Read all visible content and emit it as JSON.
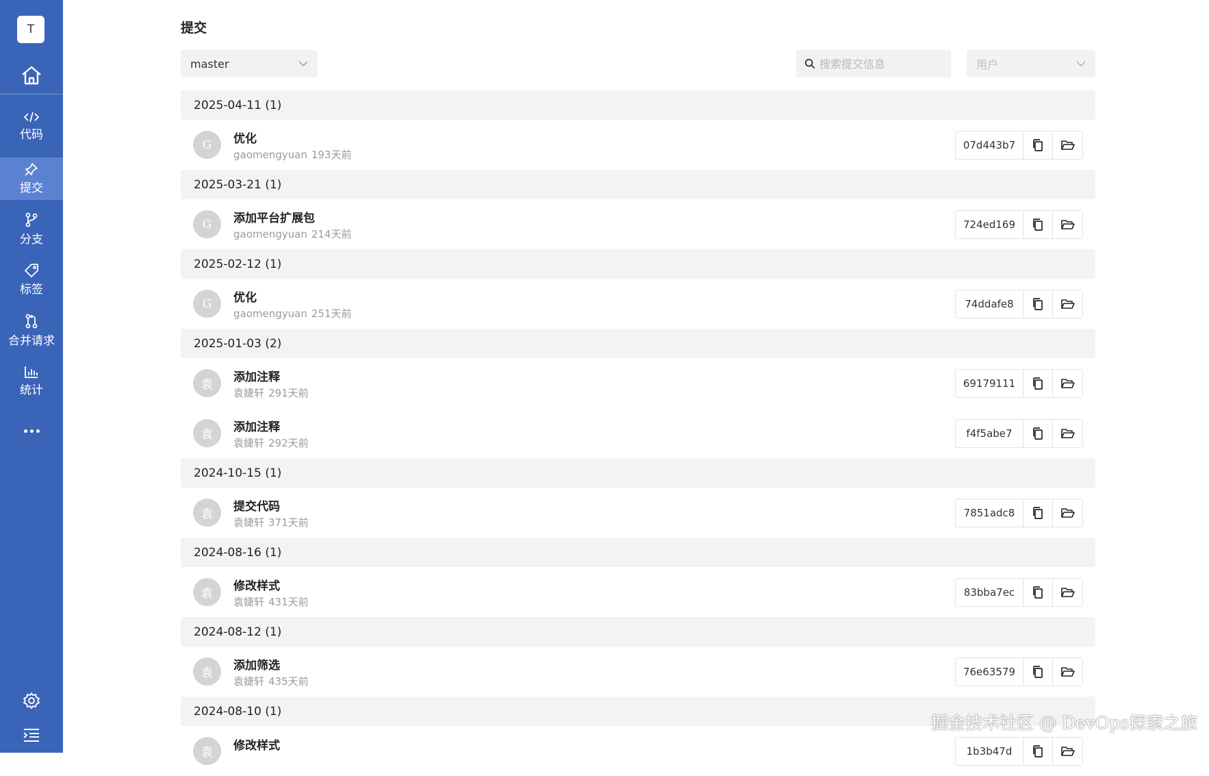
{
  "sidebar": {
    "user_initial": "T",
    "items": [
      {
        "label": "代码",
        "icon": "code-icon"
      },
      {
        "label": "提交",
        "icon": "pin-icon",
        "active": true
      },
      {
        "label": "分支",
        "icon": "branch-icon"
      },
      {
        "label": "标签",
        "icon": "tag-icon"
      },
      {
        "label": "合并请求",
        "icon": "merge-request-icon"
      },
      {
        "label": "统计",
        "icon": "bar-chart-icon"
      }
    ],
    "accent_color": "#3a64b8",
    "active_color": "#5b82d0"
  },
  "page": {
    "title": "提交",
    "branch": "master",
    "search_placeholder": "搜索提交信息",
    "user_filter_placeholder": "用户"
  },
  "groups": [
    {
      "date": "2025-04-11 (1)",
      "commits": [
        {
          "avatar": "G",
          "title": "优化",
          "author": "gaomengyuan",
          "time": "193天前",
          "hash": "07d443b7"
        }
      ]
    },
    {
      "date": "2025-03-21 (1)",
      "commits": [
        {
          "avatar": "G",
          "title": "添加平台扩展包",
          "author": "gaomengyuan",
          "time": "214天前",
          "hash": "724ed169"
        }
      ]
    },
    {
      "date": "2025-02-12 (1)",
      "commits": [
        {
          "avatar": "G",
          "title": "优化",
          "author": "gaomengyuan",
          "time": "251天前",
          "hash": "74ddafe8"
        }
      ]
    },
    {
      "date": "2025-01-03 (2)",
      "commits": [
        {
          "avatar": "袁",
          "title": "添加注释",
          "author": "袁婕轩",
          "time": "291天前",
          "hash": "69179111"
        },
        {
          "avatar": "袁",
          "title": "添加注释",
          "author": "袁婕轩",
          "time": "292天前",
          "hash": "f4f5abe7"
        }
      ]
    },
    {
      "date": "2024-10-15 (1)",
      "commits": [
        {
          "avatar": "袁",
          "title": "提交代码",
          "author": "袁婕轩",
          "time": "371天前",
          "hash": "7851adc8"
        }
      ]
    },
    {
      "date": "2024-08-16 (1)",
      "commits": [
        {
          "avatar": "袁",
          "title": "修改样式",
          "author": "袁婕轩",
          "time": "431天前",
          "hash": "83bba7ec"
        }
      ]
    },
    {
      "date": "2024-08-12 (1)",
      "commits": [
        {
          "avatar": "袁",
          "title": "添加筛选",
          "author": "袁婕轩",
          "time": "435天前",
          "hash": "76e63579"
        }
      ]
    },
    {
      "date": "2024-08-10 (1)",
      "commits": [
        {
          "avatar": "袁",
          "title": "修改样式",
          "author": "",
          "time": "",
          "hash": "1b3b47d"
        }
      ]
    }
  ],
  "watermark": "掘金技术社区 @ DevOps探索之旅"
}
